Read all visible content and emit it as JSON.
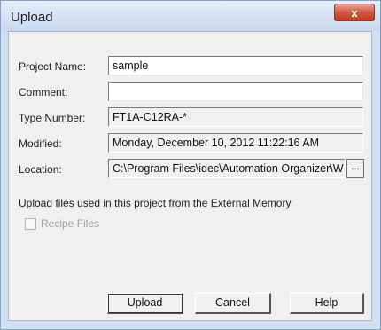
{
  "window": {
    "title": "Upload",
    "close_label": "x"
  },
  "labels": {
    "project_name": "Project Name:",
    "comment": "Comment:",
    "type_number": "Type Number:",
    "modified": "Modified:",
    "location": "Location:"
  },
  "fields": {
    "project_name": "sample",
    "comment": "",
    "type_number": "FT1A-C12RA-*",
    "modified": "Monday, December 10, 2012 11:22:16 AM",
    "location": "C:\\Program Files\\idec\\Automation Organizer\\W",
    "browse_label": "..."
  },
  "upload_section": {
    "text": "Upload files used in this project from the External Memory",
    "recipe_checkbox_label": "Recipe Files",
    "recipe_checked": false,
    "recipe_enabled": false
  },
  "buttons": {
    "upload": "Upload",
    "cancel": "Cancel",
    "help": "Help"
  }
}
